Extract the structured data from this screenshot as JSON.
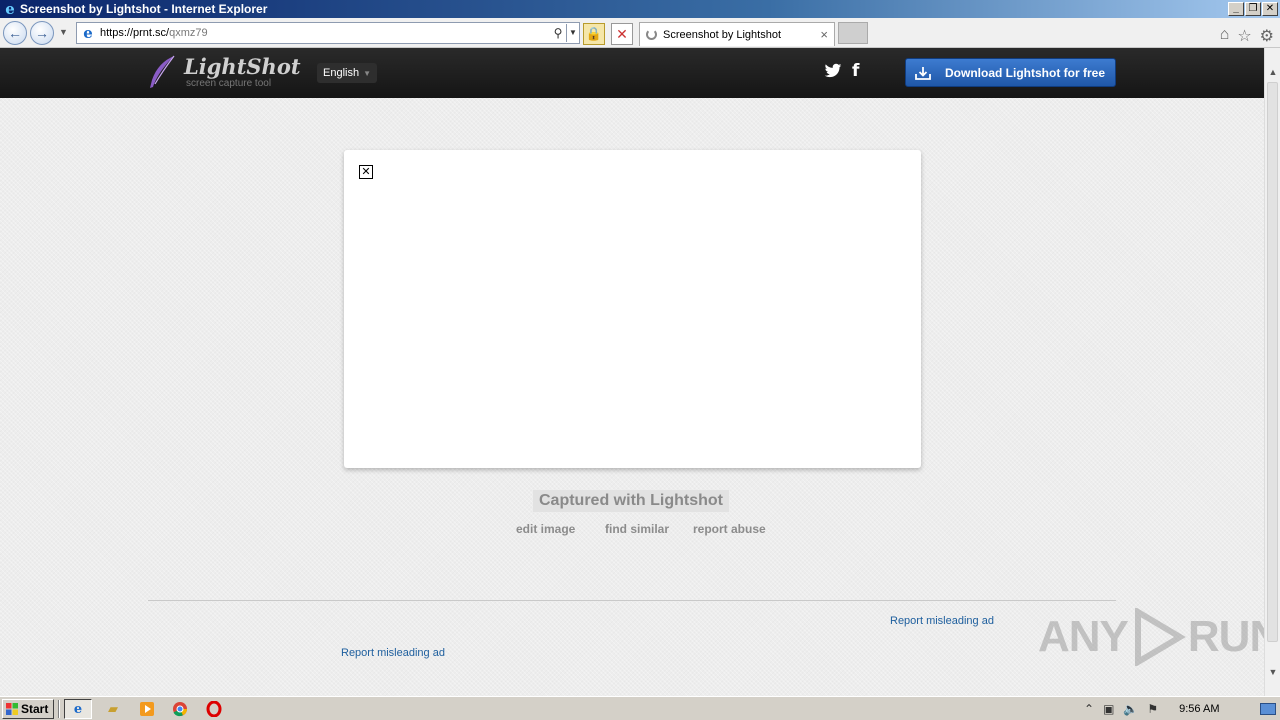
{
  "window": {
    "title": "Screenshot by Lightshot - Internet Explorer",
    "controls": [
      "_",
      "❐",
      "✕"
    ]
  },
  "address_bar": {
    "url_host": "https://prnt.sc/",
    "url_path": "qxmz79"
  },
  "tab": {
    "title": "Screenshot by Lightshot"
  },
  "site": {
    "logo_name": "LightShot",
    "logo_tagline": "screen capture tool",
    "language": "English",
    "download_label": "Download Lightshot for free",
    "facebook_glyph": "f"
  },
  "content": {
    "captured_label": "Captured with Lightshot",
    "actions": {
      "edit": "edit image",
      "similar": "find similar",
      "abuse": "report abuse"
    },
    "ad_links": [
      "Report misleading ad",
      "Report misleading ad"
    ]
  },
  "watermark": {
    "left": "ANY",
    "right": "RUN"
  },
  "taskbar": {
    "start_label": "Start",
    "clock": "9:56 AM"
  },
  "colors": {
    "header_bg": "#1c1c1c",
    "download_button": "#2a66bd",
    "link": "#1e5f9e",
    "page_bg": "#ededed"
  }
}
